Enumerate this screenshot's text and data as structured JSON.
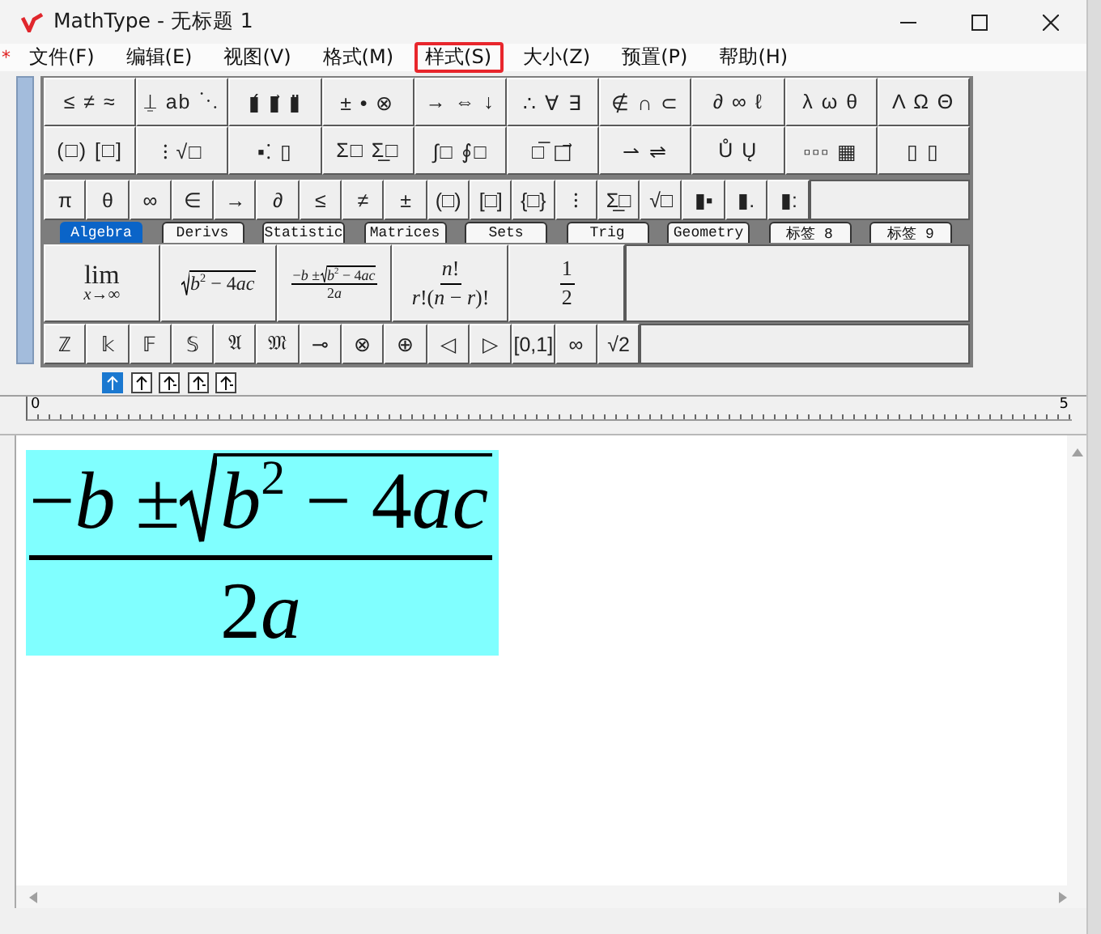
{
  "window": {
    "title": "MathType - 无标题 1"
  },
  "margin_mark": "*",
  "menu": [
    {
      "label": "文件(F)",
      "highlighted": false
    },
    {
      "label": "编辑(E)",
      "highlighted": false
    },
    {
      "label": "视图(V)",
      "highlighted": false
    },
    {
      "label": "格式(M)",
      "highlighted": false
    },
    {
      "label": "样式(S)",
      "highlighted": true
    },
    {
      "label": "大小(Z)",
      "highlighted": false
    },
    {
      "label": "预置(P)",
      "highlighted": false
    },
    {
      "label": "帮助(H)",
      "highlighted": false
    }
  ],
  "palette": {
    "symbol_rows": [
      [
        "≤ ≠ ≈",
        "⍊ ab ⋱",
        "▮́ ▮⃗ ▮̈",
        "± • ⊗",
        "→ ⇔ ↓",
        "∴ ∀ ∃",
        "∉ ∩ ⊂",
        "∂ ∞ ℓ",
        "λ ω θ",
        "Λ Ω Θ"
      ],
      [
        "(□) [□]",
        "⁝ √□",
        "▪⁚ ▯",
        "Σ□ Σ̲□",
        "∫□ ∮□",
        "□̅ □⃗",
        "⇀ ⇌",
        "Ů Ų",
        "▫▫▫ ▦",
        "▯ ▯"
      ]
    ],
    "small_row": [
      "π",
      "θ",
      "∞",
      "∈",
      "→",
      "∂",
      "≤",
      "≠",
      "±",
      "(□)",
      "[□]",
      "{□}",
      "⁝",
      "Σ̲□",
      "√□",
      "▮▪",
      "▮.",
      "▮:"
    ],
    "tabs": [
      {
        "label": "Algebra",
        "selected": true
      },
      {
        "label": "Derivs",
        "selected": false
      },
      {
        "label": "Statistic",
        "selected": false
      },
      {
        "label": "Matrices",
        "selected": false
      },
      {
        "label": "Sets",
        "selected": false
      },
      {
        "label": "Trig",
        "selected": false
      },
      {
        "label": "Geometry",
        "selected": false
      },
      {
        "label": "标签 8",
        "selected": false
      },
      {
        "label": "标签 9",
        "selected": false
      }
    ],
    "templates": [
      {
        "kind": "limit",
        "main": "lim",
        "under": "*x*→∞"
      },
      {
        "kind": "sqrt",
        "body": [
          "*b*$^{2}$ − 4",
          "*ac*"
        ]
      },
      {
        "kind": "frac",
        "num": [
          "−*b* ± ",
          {
            "kind": "sqrt",
            "body": [
              "*b*$^{2}$ − 4",
              "*ac*"
            ]
          }
        ],
        "den": [
          "2",
          "*a*"
        ]
      },
      {
        "kind": "frac",
        "num": [
          "*n*!"
        ],
        "den": [
          "*r*!(*n* − *r*)!"
        ]
      },
      {
        "kind": "frac",
        "num": [
          "1"
        ],
        "den": [
          "2"
        ]
      }
    ],
    "bottom_row": [
      "ℤ",
      "𝕜",
      "𝔽",
      "𝕊",
      "𝔄",
      "𝔐",
      "⊸",
      "⊗",
      "⊕",
      "◁",
      "▷",
      "[0,1]",
      "∞",
      "√2"
    ]
  },
  "nudge_buttons": [
    {
      "selected": true
    },
    {
      "selected": false
    },
    {
      "selected": false
    },
    {
      "selected": false
    },
    {
      "selected": false
    }
  ],
  "ruler": {
    "labels": [
      "0",
      "5"
    ]
  },
  "document": {
    "selected": true,
    "equation": {
      "kind": "frac",
      "num": [
        "−*b* ± ",
        {
          "kind": "sqrt",
          "body": [
            "*b*$^{2}$ − 4",
            "*ac*"
          ]
        }
      ],
      "den": [
        "2",
        "*a*"
      ]
    }
  }
}
